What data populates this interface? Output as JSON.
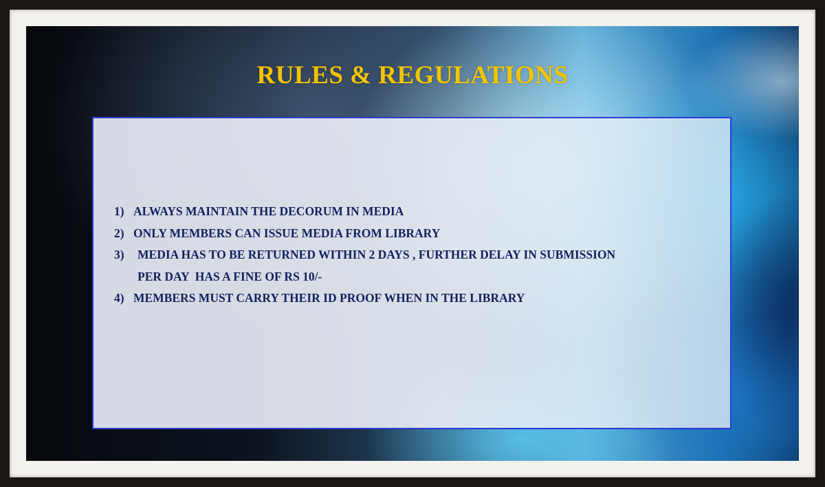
{
  "slide": {
    "title": "RULES & REGULATIONS",
    "rules": [
      {
        "number": "1)",
        "text": "ALWAYS MAINTAIN THE DECORUM IN MEDIA"
      },
      {
        "number": "2)",
        "text": "ONLY MEMBERS CAN ISSUE MEDIA FROM LIBRARY"
      },
      {
        "number": "3)",
        "text": "MEDIA HAS TO BE RETURNED WITHIN 2 DAYS , FURTHER DELAY IN SUBMISSION",
        "continuation": "PER DAY  HAS A FINE OF RS 10/-"
      },
      {
        "number": "4)",
        "text": "MEMBERS MUST CARRY THEIR ID PROOF WHEN IN THE LIBRARY"
      }
    ]
  },
  "colors": {
    "title": "#f2c400",
    "rule_text": "#14215e",
    "box_border": "#2a3ad8"
  }
}
